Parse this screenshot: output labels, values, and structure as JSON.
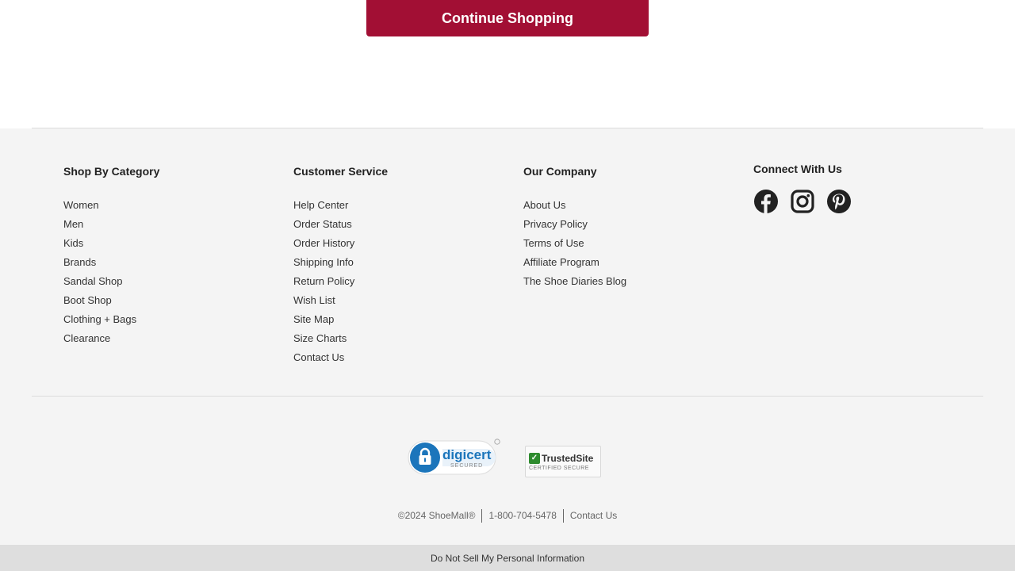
{
  "main": {
    "continue_label": "Continue Shopping"
  },
  "footer": {
    "columns": [
      {
        "title": "Shop By Category",
        "links": [
          "Women",
          "Men",
          "Kids",
          "Brands",
          "Sandal Shop",
          "Boot Shop",
          "Clothing + Bags",
          "Clearance"
        ]
      },
      {
        "title": "Customer Service",
        "links": [
          "Help Center",
          "Order Status",
          "Order History",
          "Shipping Info",
          "Return Policy",
          "Wish List",
          "Site Map",
          "Size Charts",
          "Contact Us"
        ]
      },
      {
        "title": "Our Company",
        "links": [
          "About Us",
          "Privacy Policy",
          "Terms of Use",
          "Affiliate Program",
          "The Shoe Diaries Blog"
        ]
      }
    ],
    "social": {
      "title": "Connect With Us",
      "icons": [
        "facebook-icon",
        "instagram-icon",
        "pinterest-icon"
      ]
    },
    "badges": {
      "digicert": {
        "name": "digicert",
        "sub": "SECURED"
      },
      "trustedsite": {
        "name": "TrustedSite",
        "sub": "CERTIFIED SECURE"
      }
    },
    "bottom": {
      "copyright": "©2024 ShoeMall®",
      "phone": "1-800-704-5478",
      "contact": "Contact Us"
    },
    "do_not_sell": "Do Not Sell My Personal Information"
  },
  "colors": {
    "brand": "#a20f34",
    "footer_bg": "#f4f4f4",
    "digicert_blue": "#1b75bb"
  }
}
